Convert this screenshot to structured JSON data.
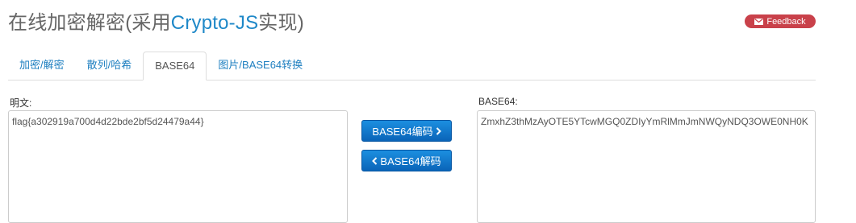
{
  "header": {
    "title_prefix": "在线加密解密(采用",
    "title_brand": "Crypto-JS",
    "title_suffix": "实现)",
    "feedback_label": "Feedback"
  },
  "tabs": [
    {
      "label": "加密/解密"
    },
    {
      "label": "散列/哈希"
    },
    {
      "label": "BASE64",
      "active": true
    },
    {
      "label": "图片/BASE64转换"
    }
  ],
  "plaintext": {
    "label": "明文:",
    "value": "flag{a302919a700d4d22bde2bf5d24479a44}"
  },
  "base64": {
    "label": "BASE64:",
    "value": "ZmxhZ3thMzAyOTE5YTcwMGQ0ZDIyYmRlMmJmNWQyNDQ3OWE0NH0K"
  },
  "buttons": {
    "encode_label": "BASE64编码",
    "decode_label": "BASE64解码"
  },
  "colors": {
    "brand": "#1e88c8",
    "feedback_bg": "#c9414a",
    "button_blue": "#0a64b8",
    "tab_link": "#1e7fc0"
  }
}
